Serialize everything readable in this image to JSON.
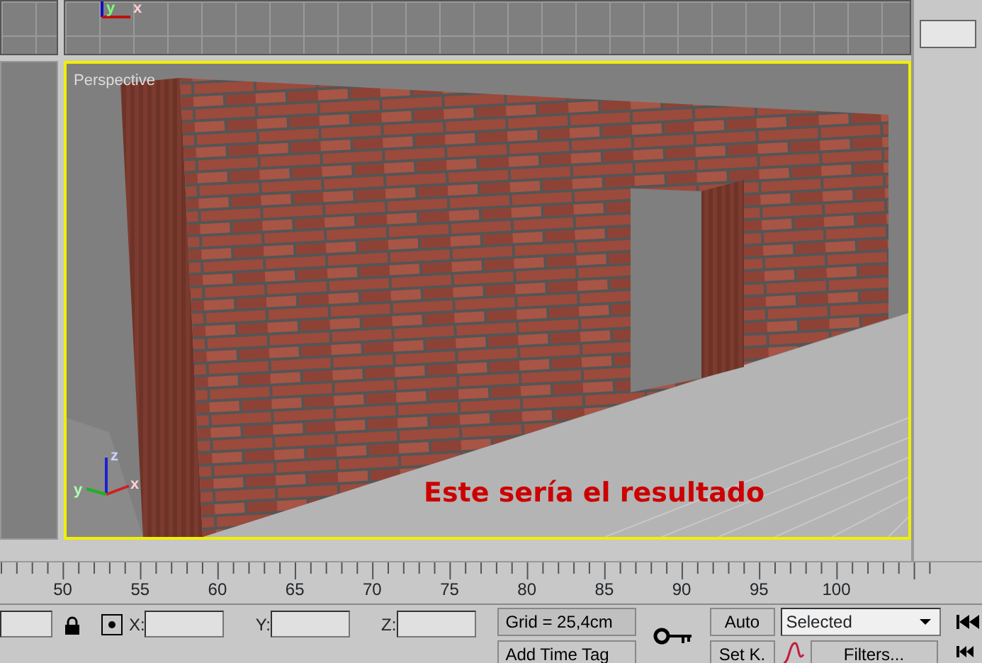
{
  "top_viewport": {
    "axis_labels": [
      "y",
      "x"
    ]
  },
  "perspective_viewport": {
    "label": "Perspective",
    "active": true,
    "axis_labels": [
      "z",
      "y",
      "x"
    ],
    "caption": "Este sería el resultado"
  },
  "timeline": {
    "ticks": [
      "50",
      "55",
      "60",
      "65",
      "70",
      "75",
      "80",
      "85",
      "90",
      "95",
      "100"
    ]
  },
  "status_bar": {
    "coordinates": [
      {
        "axis": "X:"
      },
      {
        "axis": "Y:"
      },
      {
        "axis": "Z:"
      }
    ],
    "grid": "Grid = 25,4cm",
    "time_tag": "Add Time Tag",
    "key_buttons": [
      "Auto",
      "Set K."
    ],
    "key_filter": "Selected",
    "filters_button": "Filters..."
  }
}
